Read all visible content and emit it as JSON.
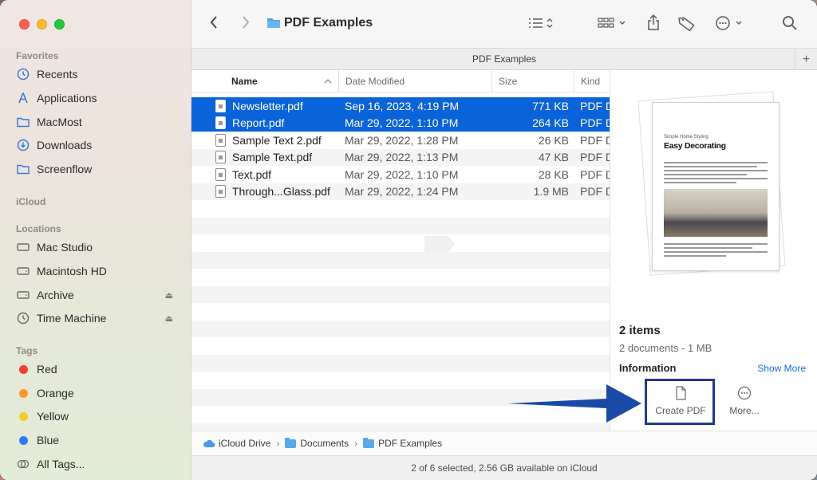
{
  "window": {
    "title": "PDF Examples"
  },
  "sidebar": {
    "favorites_label": "Favorites",
    "favorites": [
      {
        "label": "Recents",
        "icon": "clock-icon"
      },
      {
        "label": "Applications",
        "icon": "applications-icon"
      },
      {
        "label": "MacMost",
        "icon": "folder-icon"
      },
      {
        "label": "Downloads",
        "icon": "download-icon"
      },
      {
        "label": "Screenflow",
        "icon": "folder-icon"
      }
    ],
    "icloud_label": "iCloud",
    "locations_label": "Locations",
    "locations": [
      {
        "label": "Mac Studio",
        "icon": "computer-icon"
      },
      {
        "label": "Macintosh HD",
        "icon": "disk-icon"
      },
      {
        "label": "Archive",
        "icon": "disk-icon",
        "eject": true
      },
      {
        "label": "Time Machine",
        "icon": "time-machine-icon",
        "eject": true
      }
    ],
    "tags_label": "Tags",
    "tags": [
      {
        "label": "Red",
        "color": "#f23c36"
      },
      {
        "label": "Orange",
        "color": "#f79a2b"
      },
      {
        "label": "Yellow",
        "color": "#f5cc2b"
      },
      {
        "label": "Blue",
        "color": "#2f7cf6"
      },
      {
        "label": "All Tags...",
        "color": ""
      }
    ]
  },
  "toolbar": {
    "title": "PDF Examples"
  },
  "tabbar": {
    "label": "PDF Examples",
    "plus": "+"
  },
  "list": {
    "headers": {
      "name": "Name",
      "date": "Date Modified",
      "size": "Size",
      "kind": "Kind"
    },
    "rows": [
      {
        "name": "Newsletter.pdf",
        "date": "Sep 16, 2023, 4:19 PM",
        "size": "771 KB",
        "kind": "PDF D",
        "selected": true
      },
      {
        "name": "Report.pdf",
        "date": "Mar 29, 2022, 1:10 PM",
        "size": "264 KB",
        "kind": "PDF D",
        "selected": true
      },
      {
        "name": "Sample Text 2.pdf",
        "date": "Mar 29, 2022, 1:28 PM",
        "size": "26 KB",
        "kind": "PDF D",
        "selected": false
      },
      {
        "name": "Sample Text.pdf",
        "date": "Mar 29, 2022, 1:13 PM",
        "size": "47 KB",
        "kind": "PDF D",
        "selected": false
      },
      {
        "name": "Text.pdf",
        "date": "Mar 29, 2022, 1:10 PM",
        "size": "28 KB",
        "kind": "PDF D",
        "selected": false
      },
      {
        "name": "Through...Glass.pdf",
        "date": "Mar 29, 2022, 1:24 PM",
        "size": "1.9 MB",
        "kind": "PDF D",
        "selected": false
      }
    ]
  },
  "preview": {
    "doc_kicker": "Simple Home Styling",
    "doc_heading": "Easy Decorating",
    "items": "2 items",
    "sub": "2 documents - 1 MB",
    "information": "Information",
    "show_more": "Show More",
    "create_pdf": "Create PDF",
    "more": "More..."
  },
  "pathbar": {
    "segments": [
      "iCloud Drive",
      "Documents",
      "PDF Examples"
    ]
  },
  "status": "2 of 6 selected, 2.56 GB available on iCloud",
  "colors": {
    "selection": "#0a63d8",
    "highlight_box": "#22388f",
    "arrow": "#1a4aa8"
  }
}
